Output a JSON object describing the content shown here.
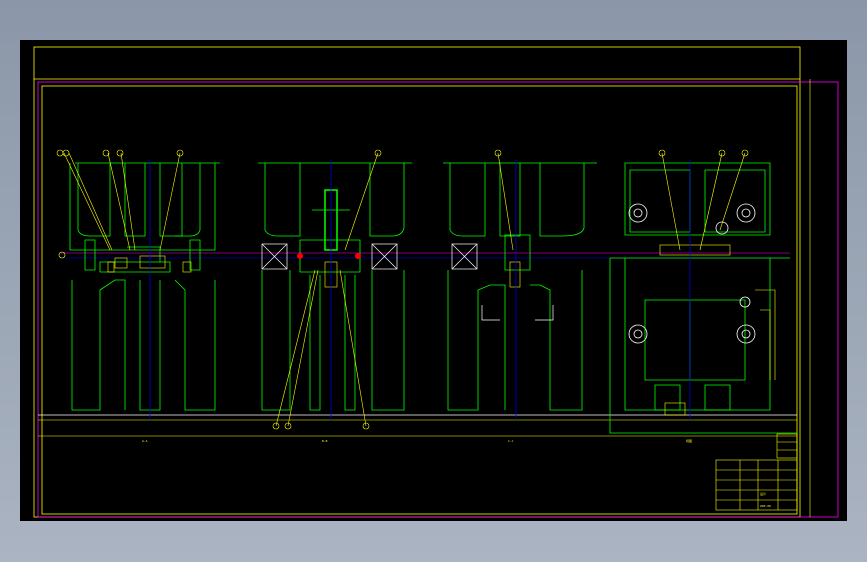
{
  "drawing": {
    "background_color": "#000000",
    "viewer_background": "#98a3b3",
    "colors": {
      "frame_yellow": "#ffff00",
      "frame_magenta": "#ff00ff",
      "part_green": "#00ff00",
      "center_blue": "#0000ff",
      "center_magenta": "#ff00ff",
      "marker_red": "#ff0000",
      "text_white": "#ffffff"
    },
    "views": [
      {
        "name": "section-view-a",
        "caption": "A-A"
      },
      {
        "name": "section-view-b",
        "caption": "B-B"
      },
      {
        "name": "section-view-c",
        "caption": "C-C"
      },
      {
        "name": "side-view",
        "caption": "视图"
      }
    ],
    "title_block": {
      "company": "设计",
      "drawing_no": "ZDP-00"
    }
  }
}
